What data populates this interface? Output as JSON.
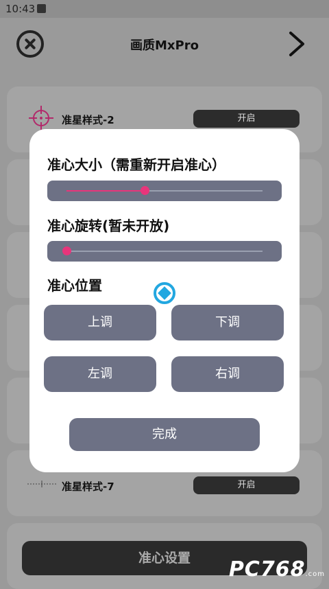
{
  "status_bar": {
    "time": "10:43"
  },
  "header": {
    "title": "画质MxPro"
  },
  "background_list": {
    "items": [
      {
        "label": "准星样式-2",
        "toggle": "开启"
      },
      {
        "label": "准星样式-7",
        "toggle": "开启"
      }
    ]
  },
  "bottom_bar": {
    "label": "准心设置"
  },
  "watermark": {
    "text": "PC768",
    "sub": ".com"
  },
  "dialog": {
    "size_label": "准心大小（需重新开启准心）",
    "size_value_percent": 40,
    "rotation_label": "准心旋转(暂未开放)",
    "rotation_value_percent": 0,
    "position_label": "准心位置",
    "buttons": {
      "up": "上调",
      "down": "下调",
      "left": "左调",
      "right": "右调"
    },
    "done": "完成"
  },
  "colors": {
    "accent": "#e8357b",
    "button": "#6d7185",
    "crosshair_center": "#22a7e0",
    "crosshair_arms": "#c040f0"
  }
}
